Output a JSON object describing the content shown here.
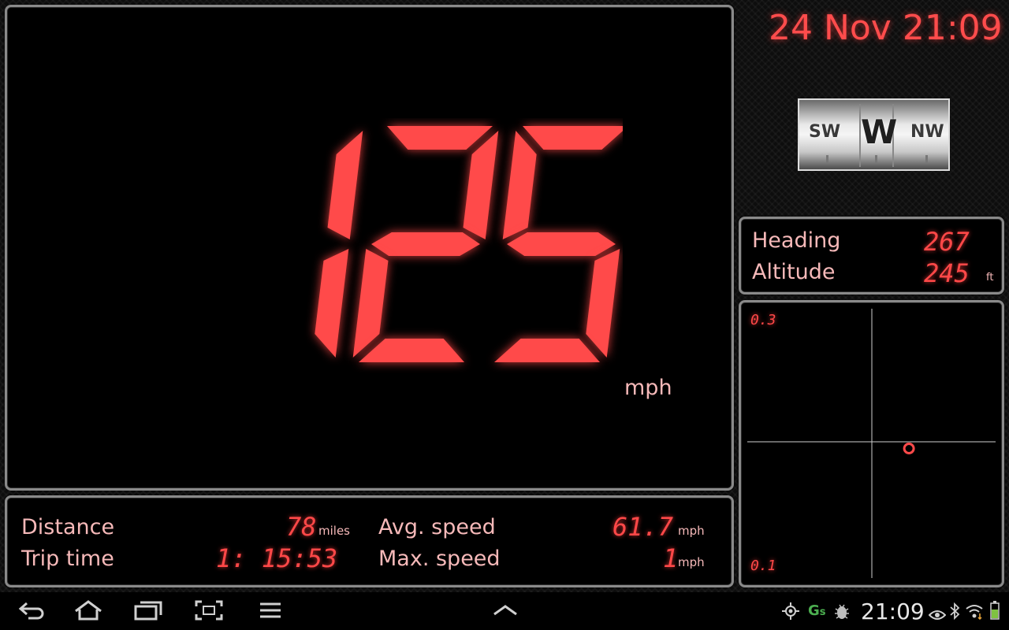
{
  "speed": {
    "value": "125",
    "unit": "mph"
  },
  "datetime": "24 Nov 21:09",
  "compass": {
    "left": "SW",
    "center": "W",
    "right": "NW"
  },
  "info": {
    "heading_label": "Heading",
    "heading_value": "267",
    "altitude_label": "Altitude",
    "altitude_value": "245",
    "altitude_unit": "ft"
  },
  "plot": {
    "top_label": "0.3",
    "bottom_label": "0.1",
    "point": {
      "x": 0.3,
      "y": -0.05
    }
  },
  "trip": {
    "distance_label": "Distance",
    "distance_value": "78",
    "distance_unit": "miles",
    "trip_time_label": "Trip time",
    "trip_time_value": "1: 15:53",
    "avg_speed_label": "Avg. speed",
    "avg_speed_value": "61.7",
    "avg_speed_unit": "mph",
    "max_speed_label": "Max. speed",
    "max_speed_value": "1",
    "max_speed_unit": "mph"
  },
  "statusbar": {
    "time": "21:09"
  },
  "icons": {
    "back": "back-icon",
    "home": "home-icon",
    "recent": "recent-apps-icon",
    "screenshot": "screenshot-icon",
    "menu": "menu-icon",
    "up": "chevron-up-icon",
    "gps": "gps-icon",
    "gs": "gs-app-icon",
    "bug": "debug-icon",
    "eye": "eye-icon",
    "bluetooth": "bluetooth-icon",
    "wifi": "wifi-icon",
    "battery": "battery-icon"
  },
  "colors": {
    "digits": "#ff4a4a",
    "labels": "#f6b9b9",
    "panel_border": "#8a8a8a"
  }
}
